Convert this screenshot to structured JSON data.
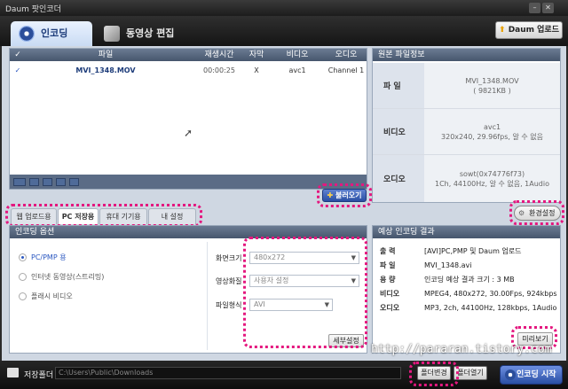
{
  "window": {
    "title": "Daum 팟인코더"
  },
  "header": {
    "tabs": [
      {
        "label": "인코딩"
      },
      {
        "label": "동영상 편집"
      }
    ],
    "upload_button": "Daum 업로드"
  },
  "file_table": {
    "columns": [
      "파일",
      "재생시간",
      "자막",
      "비디오",
      "오디오"
    ],
    "rows": [
      {
        "checked": true,
        "file": "MVI_1348.MOV",
        "duration": "00:00:25",
        "subtitle": "X",
        "video": "avc1",
        "audio": "Channel 1"
      }
    ],
    "load_button": "불러오기"
  },
  "source_info": {
    "title": "원본 파일정보",
    "rows": [
      {
        "label": "파 일",
        "lines": [
          "MVI_1348.MOV",
          "( 9821KB )"
        ]
      },
      {
        "label": "비디오",
        "lines": [
          "avc1",
          "320x240, 29.96fps, 알 수 없음"
        ]
      },
      {
        "label": "오디오",
        "lines": [
          "sowt(0x74776f73)",
          "1Ch, 44100Hz, 알 수 없음, 1Audio"
        ]
      }
    ]
  },
  "sub_tabs": [
    "웹 업로드용",
    "PC 저장용",
    "휴대 기기용",
    "내 설정"
  ],
  "settings_button": "환경설정",
  "encode_options": {
    "title": "인코딩 옵션",
    "radios": [
      {
        "label": "PC/PMP 용",
        "selected": true
      },
      {
        "label": "인터넷 동영상(스트리밍)",
        "selected": false
      },
      {
        "label": "플래시 비디오",
        "selected": false
      }
    ],
    "fields": [
      {
        "label": "화면크기",
        "value": "480x272"
      },
      {
        "label": "영상화질",
        "value": "사용자 설정"
      },
      {
        "label": "파일형식",
        "value": "AVI"
      }
    ],
    "detail_button": "세부설정"
  },
  "expected_result": {
    "title": "예상 인코딩 결과",
    "rows": [
      {
        "key": "출 력",
        "value": "[AVI]PC,PMP 및 Daum 업로드"
      },
      {
        "key": "파 일",
        "value": "MVI_1348.avi"
      },
      {
        "key": "용 량",
        "value": "인코딩 예상 결과 크기 : 3 MB"
      },
      {
        "key": "비디오",
        "value": "MPEG4, 480x272, 30.00Fps, 924kbps"
      },
      {
        "key": "오디오",
        "value": "MP3, 2ch, 44100Hz, 128kbps, 1Audio"
      }
    ],
    "preview_button": "미리보기"
  },
  "bottom": {
    "folder_label": "저장폴더",
    "folder_path": "C:\\Users\\Public\\Downloads",
    "change_folder": "폴더변경",
    "open_folder": "폴더열기",
    "start_button": "인코딩 시작"
  },
  "watermark": "http://pararan.tistory.com",
  "colors": {
    "highlight": "#e4187f",
    "accent": "#2a4fa4",
    "header_bar": "#46566d"
  }
}
